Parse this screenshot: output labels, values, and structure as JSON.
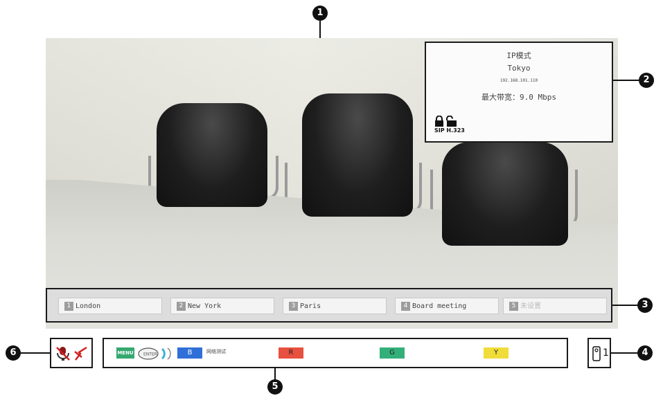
{
  "callouts": {
    "c1": "1",
    "c2": "2",
    "c3": "3",
    "c4": "4",
    "c5": "5",
    "c6": "6"
  },
  "info_box": {
    "mode": "IP模式",
    "site": "Tokyo",
    "ip": "192.168.101.110",
    "bandwidth": "最大带宽：9.0 Mbps",
    "protocols": "SIP H.323",
    "icons": [
      "lock-closed-icon",
      "lock-open-icon"
    ]
  },
  "presets": [
    {
      "num": "1",
      "label": "London"
    },
    {
      "num": "2",
      "label": "New York"
    },
    {
      "num": "3",
      "label": "Paris"
    },
    {
      "num": "4",
      "label": "Board meeting"
    },
    {
      "num": "5",
      "label": "未设置"
    }
  ],
  "nav": {
    "menu": "MENU",
    "b_key": "B",
    "b_label": "网络测试",
    "r_key": "R",
    "g_key": "G",
    "y_key": "Y"
  },
  "status": {
    "page_number": "1",
    "icons": [
      "mic-muted-icon",
      "network-error-icon",
      "remote-control-icon"
    ]
  },
  "colors": {
    "blue": "#2f6fd8",
    "red": "#e8503f",
    "green": "#33b07a",
    "yellow": "#f0dc3a",
    "menu": "#35a870"
  }
}
